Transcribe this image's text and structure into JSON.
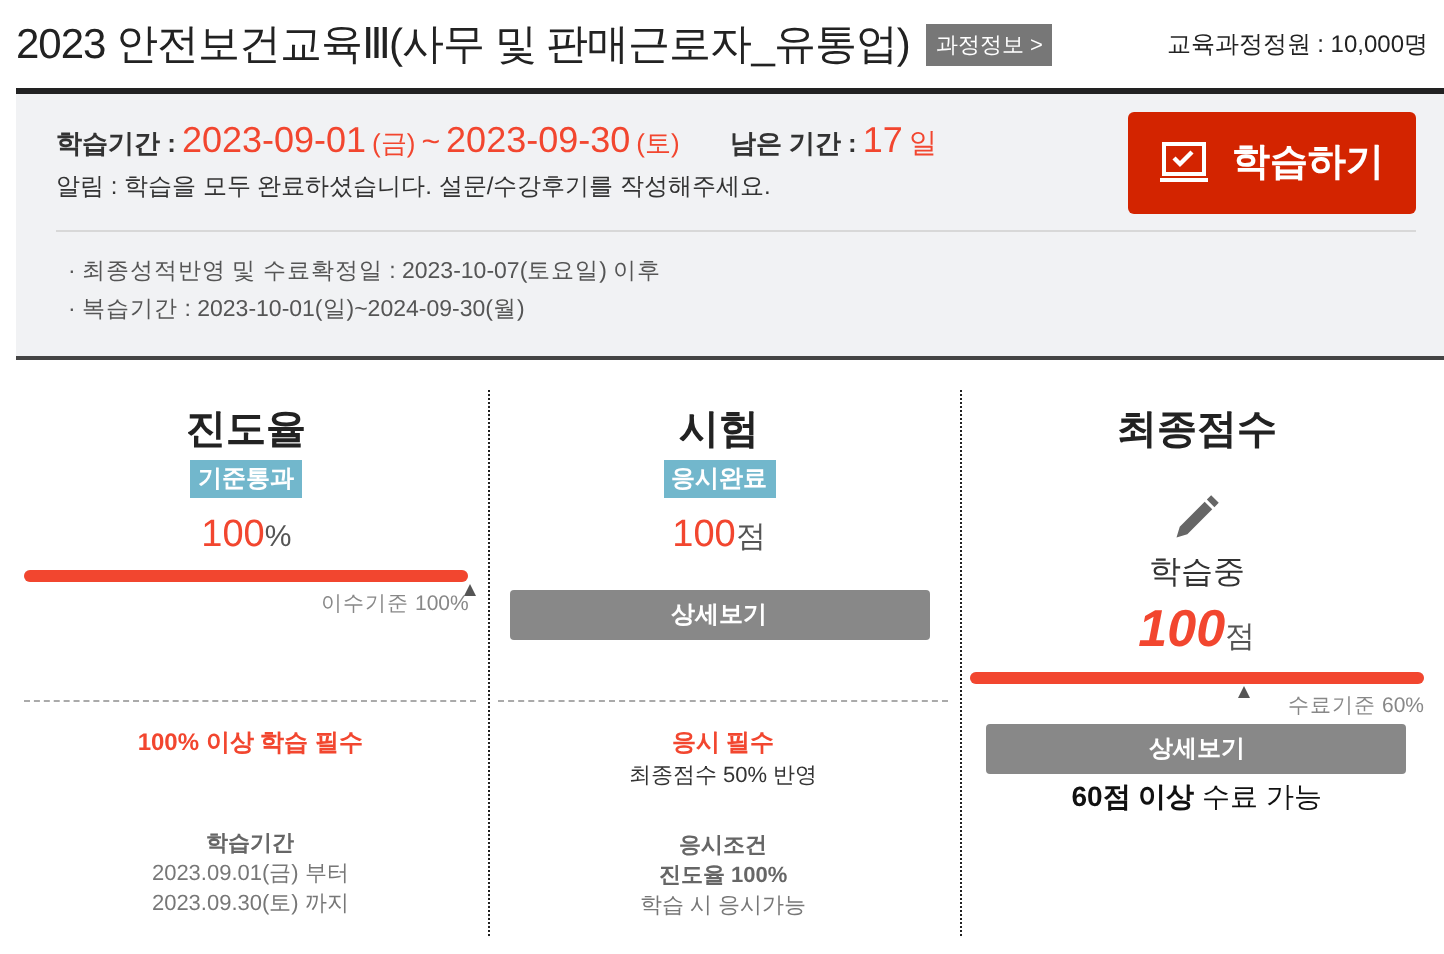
{
  "header": {
    "title": "2023 안전보건교육Ⅲ(사무 및 판매근로자_유통업)",
    "info_button": "과정정보 >",
    "capacity": "교육과정정원 : 10,000명"
  },
  "summary": {
    "period_label": "학습기간 :",
    "start": "2023-09-01",
    "start_day": "(금)",
    "separator": "~",
    "end": "2023-09-30",
    "end_day": "(토)",
    "remaining_label": "남은 기간 :",
    "remaining_value": "17",
    "remaining_unit": "일",
    "notice": "알림 : 학습을 모두 완료하셨습니다. 설문/수강후기를 작성해주세요.",
    "study_button": "학습하기",
    "notes": [
      "· 최종성적반영 및 수료확정일 : 2023-10-07(토요일) 이후",
      "· 복습기간 : 2023-10-01(일)~2024-09-30(월)"
    ]
  },
  "columns": [
    {
      "kind": "progress",
      "title": "진도율",
      "badge": "기준통과",
      "value": "100",
      "unit": "%",
      "level": 1,
      "criterion": "이수기준 100%",
      "requirement": "100% 이상 학습 필수",
      "info_title": "학습기간",
      "info_lines": [
        "2023.09.01(금) 부터",
        "2023.09.30(토) 까지"
      ]
    },
    {
      "kind": "exam",
      "title": "시험",
      "badge": "응시완료",
      "value": "100",
      "unit": "점",
      "detail_button": "상세보기",
      "requirement": "응시 필수",
      "requirement_note": "최종점수 50% 반영",
      "info_title": "응시조건",
      "info_lines": [
        "진도율 100%",
        "학습 시 응시가능"
      ]
    },
    {
      "kind": "final",
      "title": "최종점수",
      "status": "학습중",
      "value": "100",
      "unit": "점",
      "level": 1,
      "criterion": "수료기준 60%",
      "detail_button": "상세보기",
      "pass_note": "**60점 이상** 수료 가능"
    }
  ]
}
